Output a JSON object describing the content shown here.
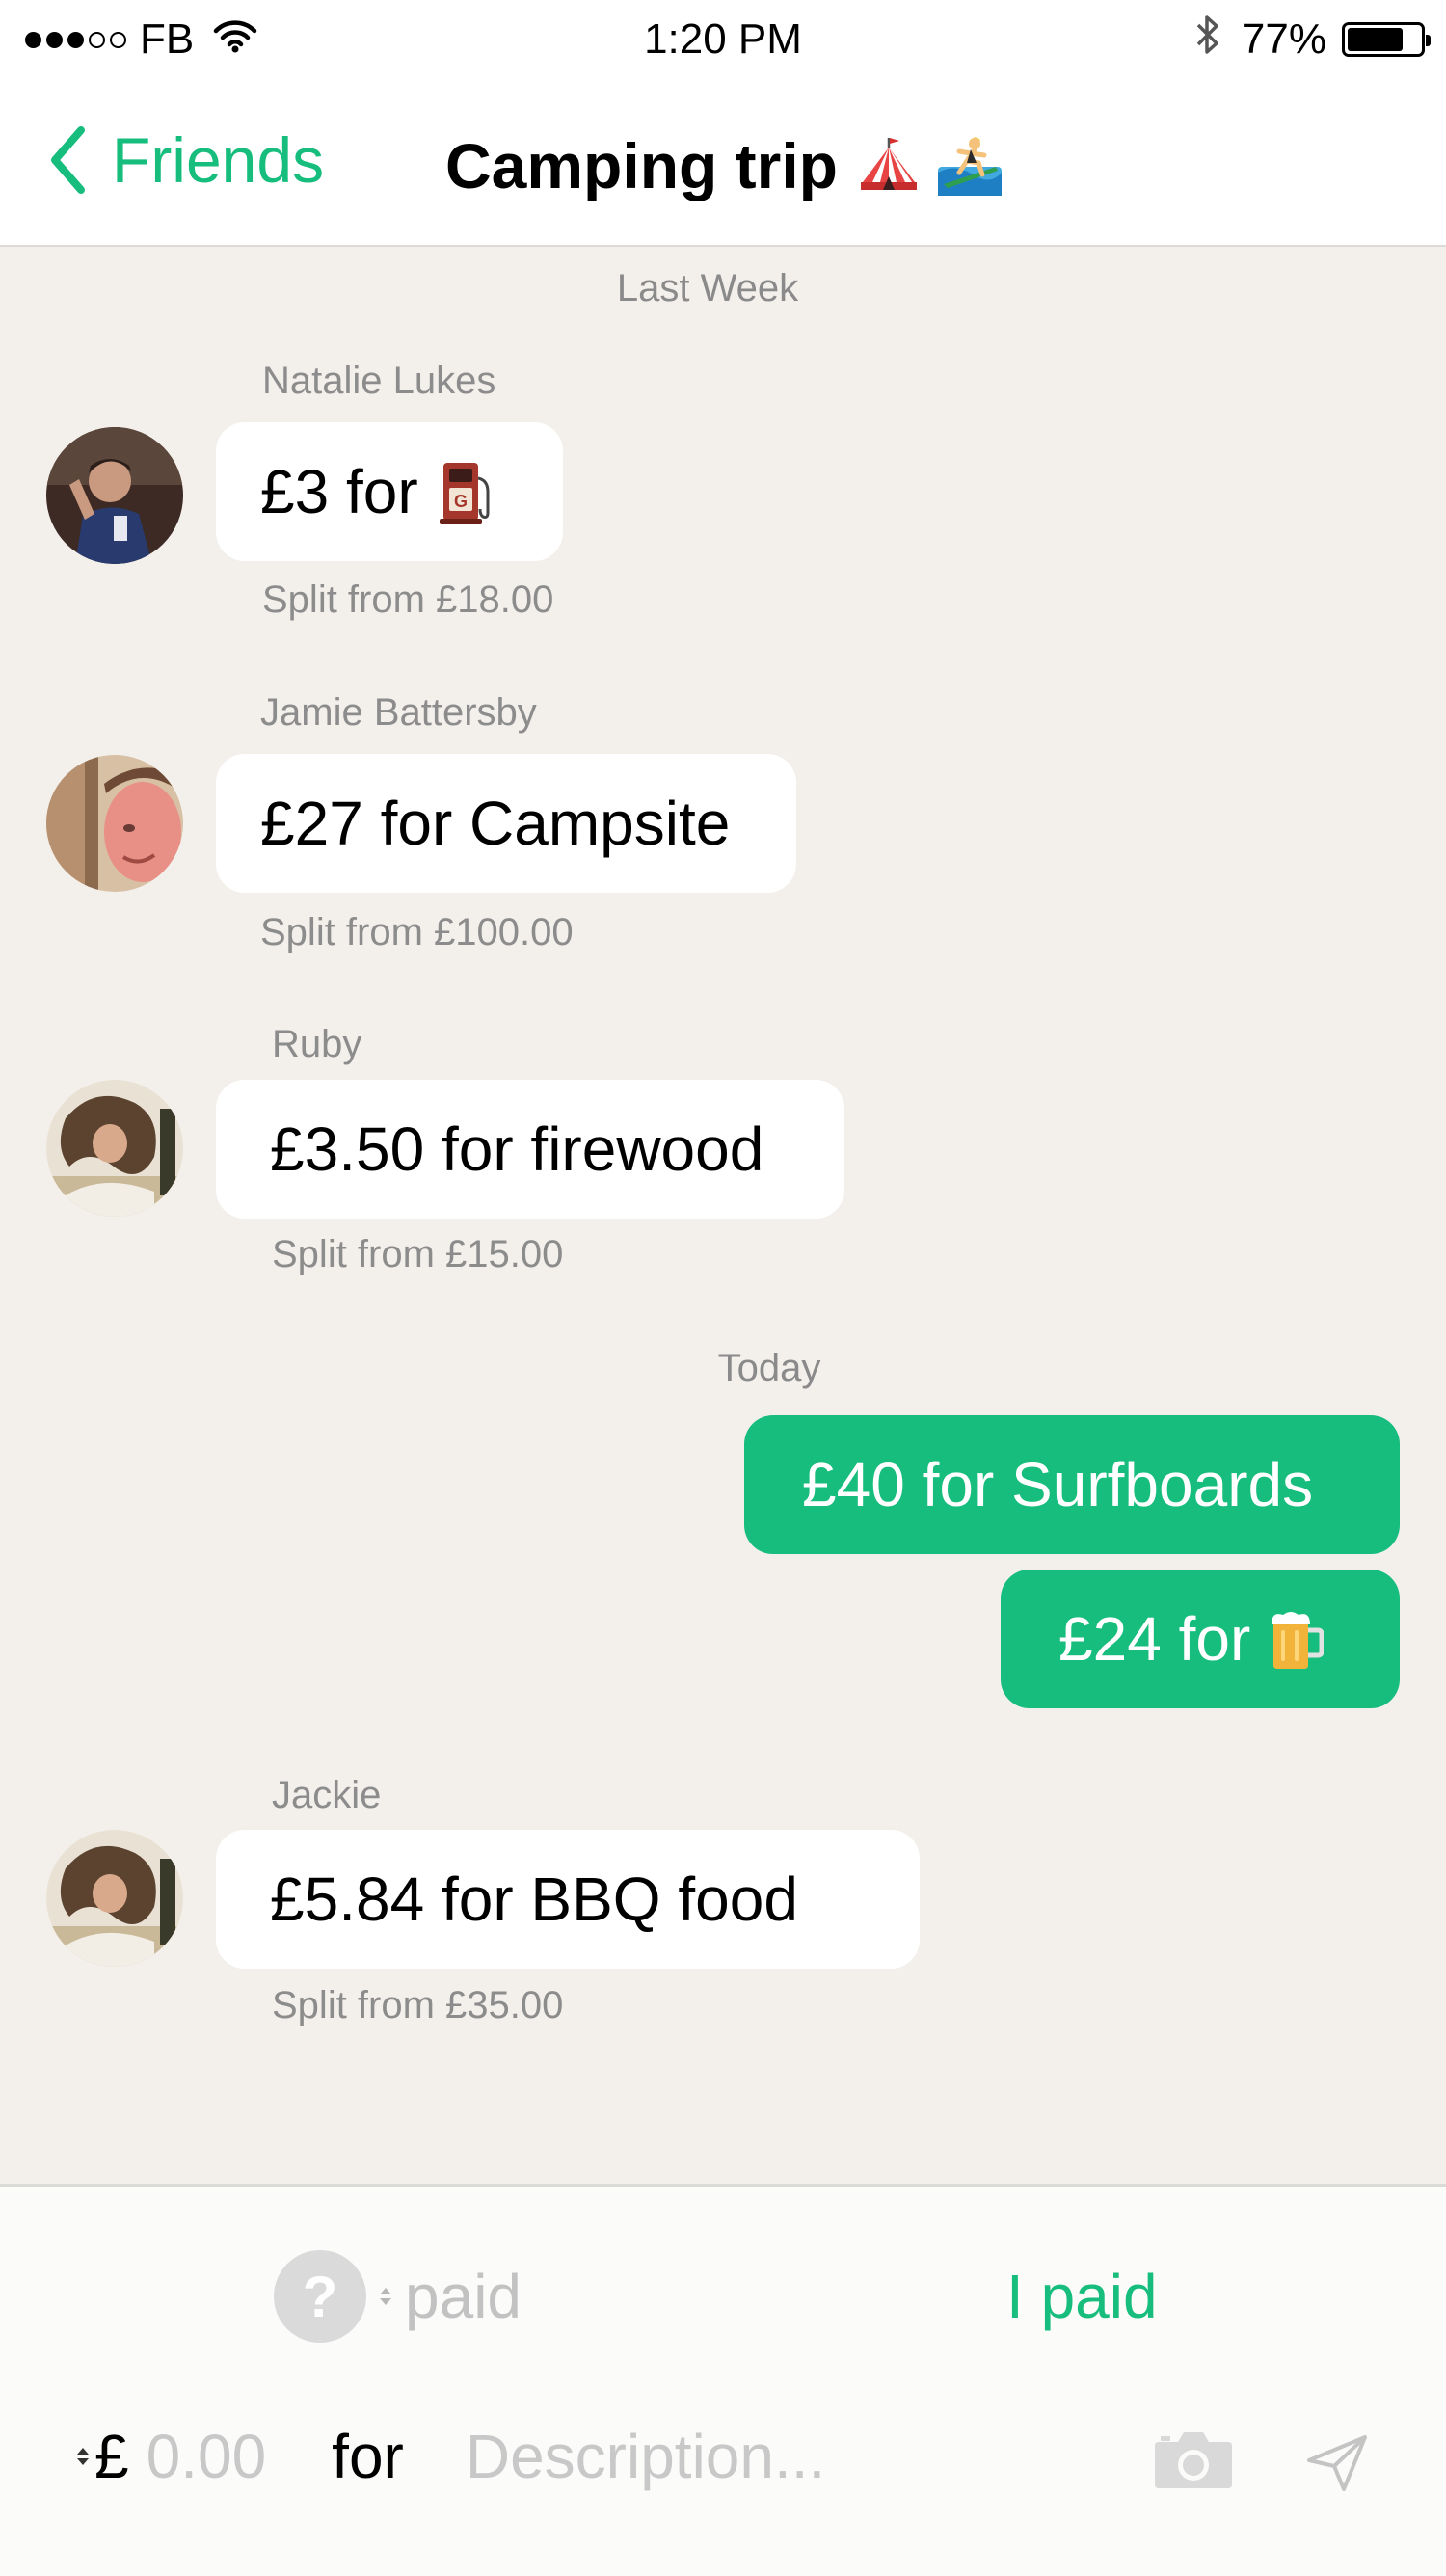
{
  "status_bar": {
    "carrier": "FB",
    "time": "1:20 PM",
    "battery": "77%",
    "battery_level": 0.77
  },
  "nav": {
    "back_label": "Friends",
    "title": "Camping trip",
    "title_emoji": [
      "🎪",
      "🏄"
    ]
  },
  "feed": {
    "section_last_week": "Last Week",
    "section_today": "Today",
    "messages": [
      {
        "sender": "Natalie Lukes",
        "text": "£3 for",
        "emoji": "⛽",
        "split": "Split from £18.00"
      },
      {
        "sender": "Jamie Battersby",
        "text": "£27 for Campsite",
        "split": "Split from £100.00"
      },
      {
        "sender": "Ruby",
        "text": "£3.50 for firewood",
        "split": "Split from £15.00"
      }
    ],
    "my_messages": [
      {
        "text": "£40 for Surfboards"
      },
      {
        "text": "£24 for",
        "emoji": "🍺"
      }
    ],
    "later_messages": [
      {
        "sender": "Jackie",
        "text": "£5.84 for BBQ food",
        "split": "Split from £35.00"
      }
    ]
  },
  "composer": {
    "payer_placeholder": "?",
    "paid_label": "paid",
    "i_paid_label": "I paid",
    "currency_symbol": "£",
    "amount_placeholder": "0.00",
    "for_label": "for",
    "description_placeholder": "Description..."
  },
  "colors": {
    "accent": "#16bd7c",
    "background": "#f3f0ec",
    "secondary_text": "#8c8c8c"
  }
}
